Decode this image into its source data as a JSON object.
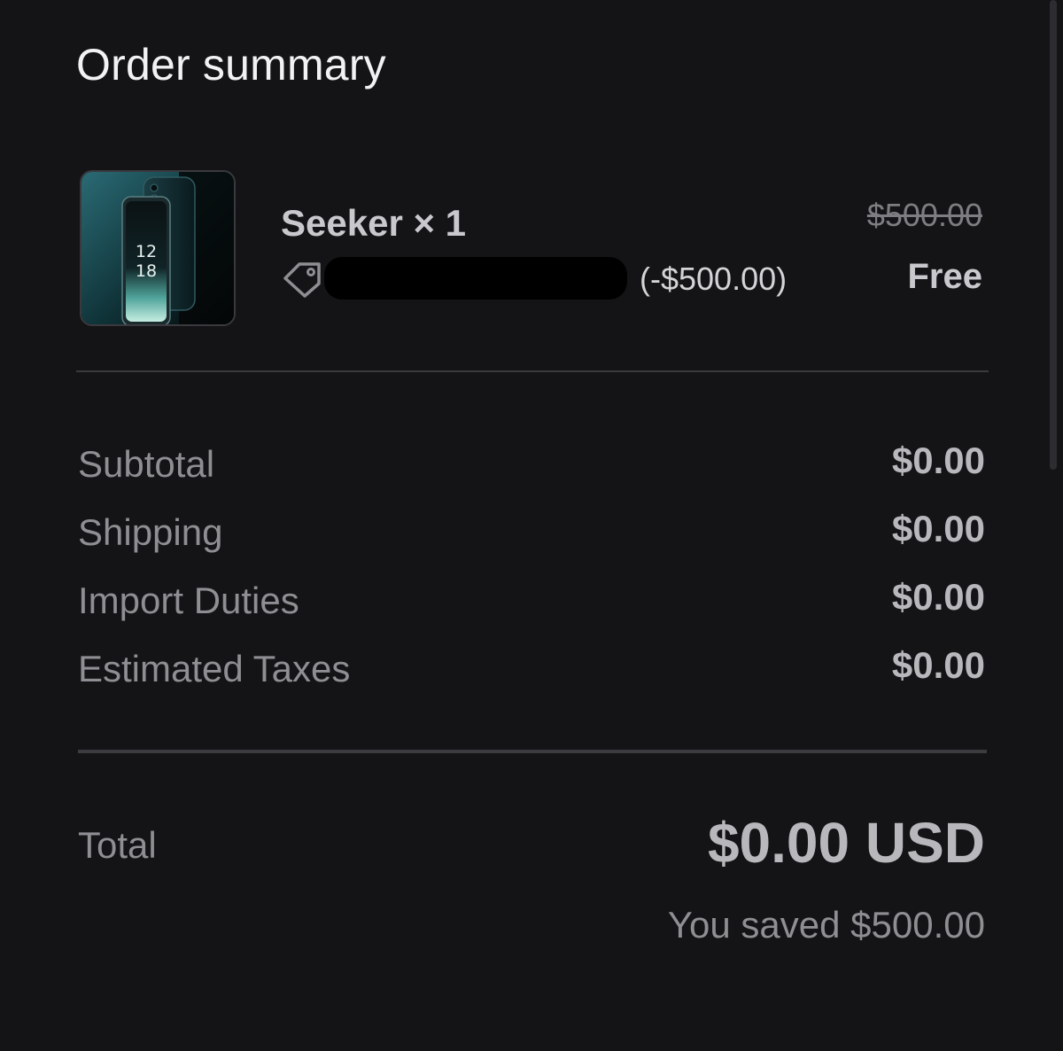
{
  "header": {
    "title": "Order summary"
  },
  "item": {
    "image_alt": "Seeker phone",
    "screen_time_hour": "12",
    "screen_time_minute": "18",
    "name": "Seeker × 1",
    "discount_icon": "tag-icon",
    "discount_code": "[redacted]",
    "discount_amount": "(-$500.00)",
    "original_price": "$500.00",
    "final_price": "Free"
  },
  "summary": {
    "rows": [
      {
        "label": "Subtotal",
        "value": "$0.00"
      },
      {
        "label": "Shipping",
        "value": "$0.00"
      },
      {
        "label": "Import Duties",
        "value": "$0.00"
      },
      {
        "label": "Estimated Taxes",
        "value": "$0.00"
      }
    ]
  },
  "total": {
    "label": "Total",
    "value": "$0.00 USD",
    "savings": "You saved $500.00"
  },
  "colors": {
    "background": "#141416",
    "label": "#8e8e93",
    "value": "#b8b8bc",
    "divider": "#3a3a3e"
  }
}
